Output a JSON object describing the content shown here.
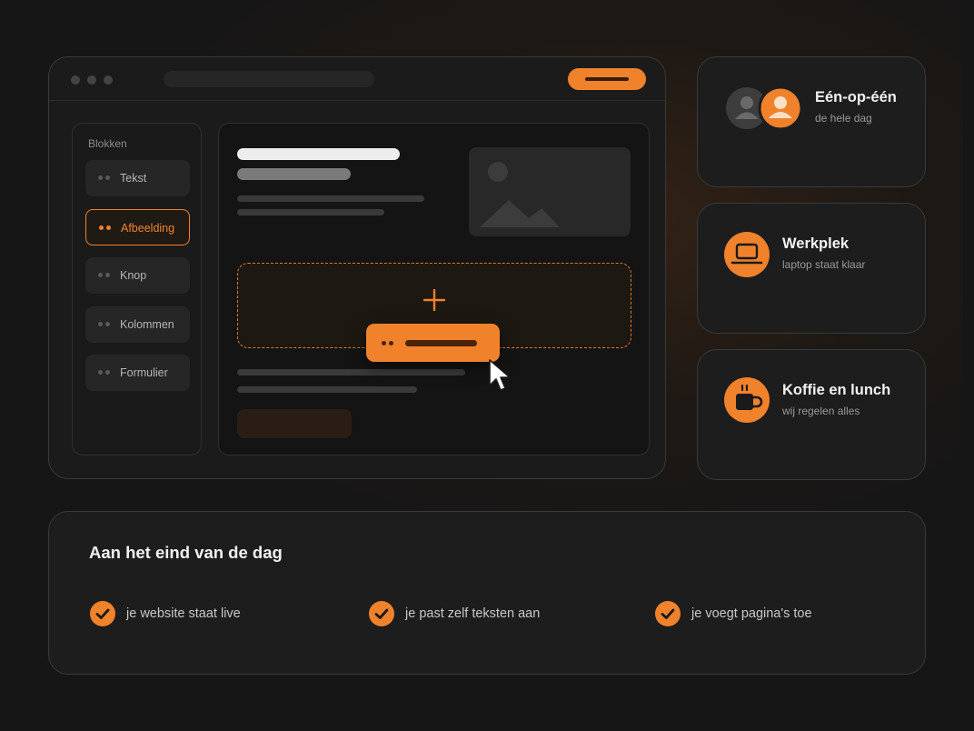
{
  "theme": {
    "accent": "#f0822c",
    "background": "#161616",
    "card": "#1d1d1d"
  },
  "builder": {
    "panel_title": "Blokken",
    "blocks": [
      {
        "label": "Tekst",
        "active": false
      },
      {
        "label": "Afbeelding",
        "active": true
      },
      {
        "label": "Knop",
        "active": false
      },
      {
        "label": "Kolommen",
        "active": false
      },
      {
        "label": "Formulier",
        "active": false
      }
    ],
    "dropzone_icon": "plus-icon",
    "cursor_icon": "mouse-pointer-icon"
  },
  "features": [
    {
      "title": "Eén-op-één",
      "subtitle": "de hele dag",
      "icon": "user-avatars-icon"
    },
    {
      "title": "Werkplek",
      "subtitle": "laptop staat klaar",
      "icon": "laptop-icon"
    },
    {
      "title": "Koffie en lunch",
      "subtitle": "wij regelen alles",
      "icon": "coffee-cup-icon"
    }
  ],
  "summary": {
    "heading": "Aan het eind van de dag",
    "items": [
      {
        "text": "je website staat live",
        "icon": "check-icon"
      },
      {
        "text": "je past zelf teksten aan",
        "icon": "check-icon"
      },
      {
        "text": "je voegt pagina's toe",
        "icon": "check-icon"
      }
    ]
  }
}
